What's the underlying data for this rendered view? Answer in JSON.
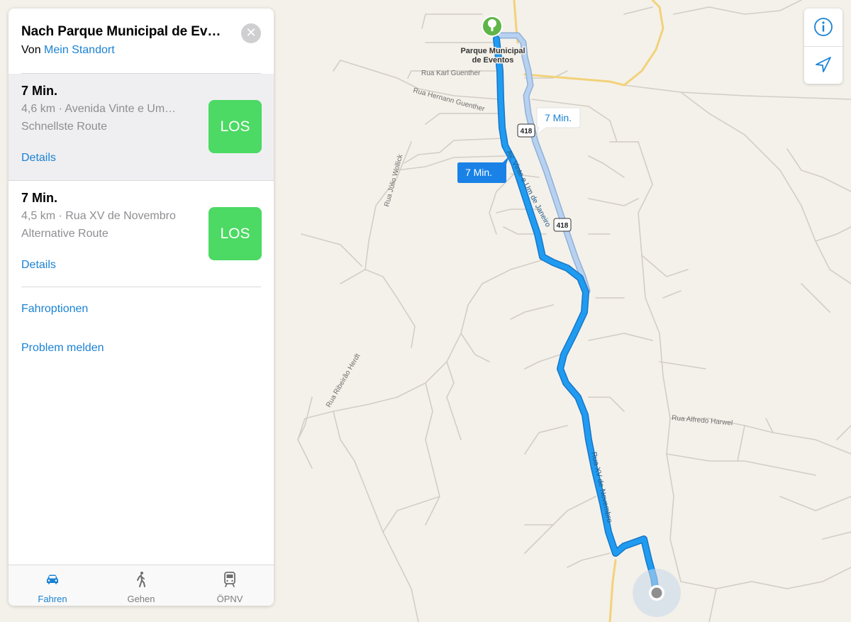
{
  "panel": {
    "title": "Nach Parque Municipal de Ev…",
    "from_prefix": "Von ",
    "from_link": "Mein Standort",
    "close_glyph": "✕",
    "routes": [
      {
        "time": "7 Min.",
        "info": "4,6 km · Avenida Vinte e Um…",
        "kind": "Schnellste Route",
        "details": "Details",
        "go": "LOS",
        "selected": true
      },
      {
        "time": "7 Min.",
        "info": "4,5 km · Rua XV de Novembro",
        "kind": "Alternative Route",
        "details": "Details",
        "go": "LOS",
        "selected": false
      }
    ],
    "options": {
      "driving": "Fahroptionen",
      "report": "Problem melden"
    }
  },
  "tabs": [
    {
      "label": "Fahren",
      "icon": "car-icon",
      "active": true
    },
    {
      "label": "Gehen",
      "icon": "walking-person-icon",
      "active": false
    },
    {
      "label": "ÖPNV",
      "icon": "train-icon",
      "active": false
    }
  ],
  "map": {
    "destination_label_line1": "Parque Municipal",
    "destination_label_line2": "de Eventos",
    "route_badge_selected": "7 Min.",
    "route_badge_alternative": "7 Min.",
    "highway_shield": "418",
    "streets": {
      "karl_guenther": "Rua Karl Guenther",
      "hernann_guenther": "Rua Hernann Guenther",
      "julio_wollick": "Rua Júlio Wollick",
      "vinte_e_um": "Av. Vinte e Um de Janeiro",
      "ribeirao_herdt": "Rua Ribeirão Herdt",
      "xv_novembro": "Rua XV de Novembro",
      "alfredo_harwel": "Rua Alfredo Harwel"
    },
    "info_icon": "info-icon",
    "location_icon": "location-arrow-icon"
  },
  "colors": {
    "route_selected": "#1f9cf2",
    "route_alternative": "#a9c8ee",
    "go_button": "#4cd964",
    "link": "#1a82d4",
    "map_background": "#f4f1ea",
    "road": "#d7d3cc",
    "major_road": "#f2d27a"
  }
}
